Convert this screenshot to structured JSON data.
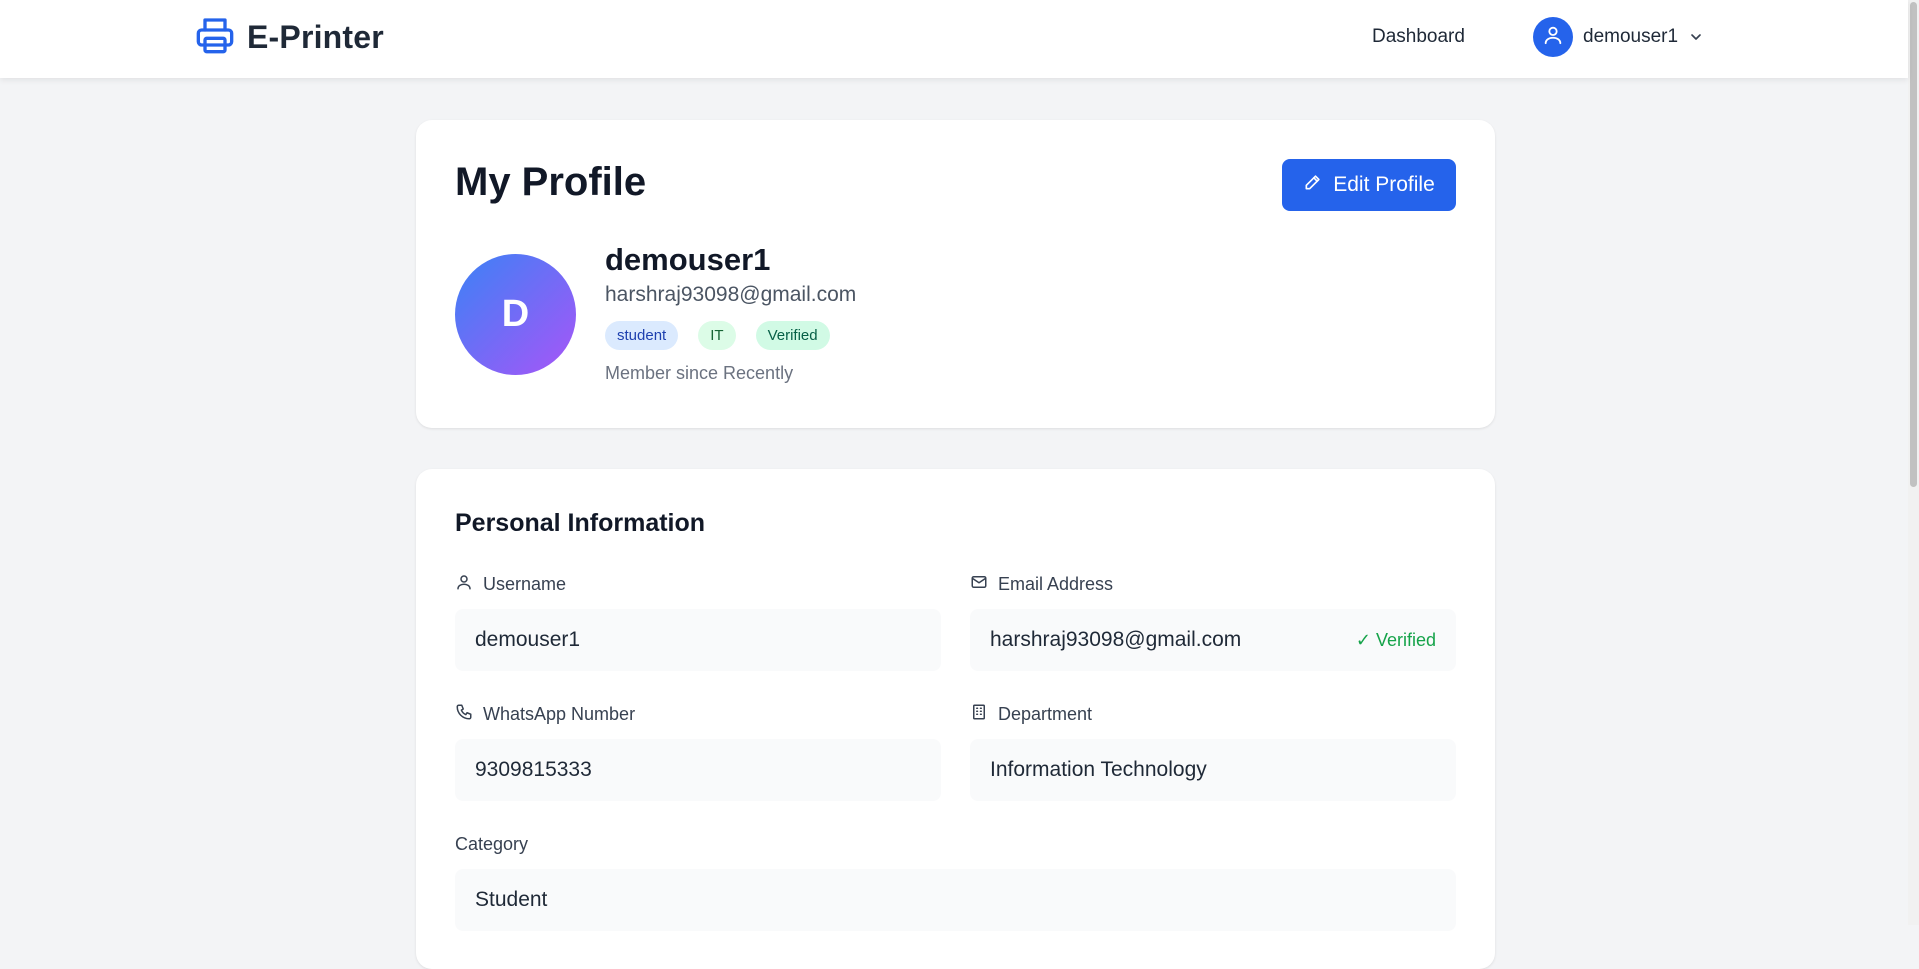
{
  "header": {
    "brand": "E-Printer",
    "nav_dashboard": "Dashboard",
    "username": "demouser1"
  },
  "profile": {
    "title": "My Profile",
    "edit_button": "Edit Profile",
    "avatar_initial": "D",
    "name": "demouser1",
    "email": "harshraj93098@gmail.com",
    "badges": {
      "role": "student",
      "department": "IT",
      "status": "Verified"
    },
    "member_since": "Member since Recently"
  },
  "personal_info": {
    "title": "Personal Information",
    "username": {
      "label": "Username",
      "value": "demouser1"
    },
    "email": {
      "label": "Email Address",
      "value": "harshraj93098@gmail.com",
      "status": "✓ Verified"
    },
    "whatsapp": {
      "label": "WhatsApp Number",
      "value": "9309815333"
    },
    "department": {
      "label": "Department",
      "value": "Information Technology"
    },
    "category": {
      "label": "Category",
      "value": "Student"
    }
  },
  "colors": {
    "accent": "#2563eb",
    "background": "#f3f4f6",
    "verified_green": "#16a34a"
  },
  "icons": [
    "printer-icon",
    "user-icon",
    "chevron-down-icon",
    "pencil-icon",
    "mail-icon",
    "phone-icon",
    "building-icon"
  ]
}
